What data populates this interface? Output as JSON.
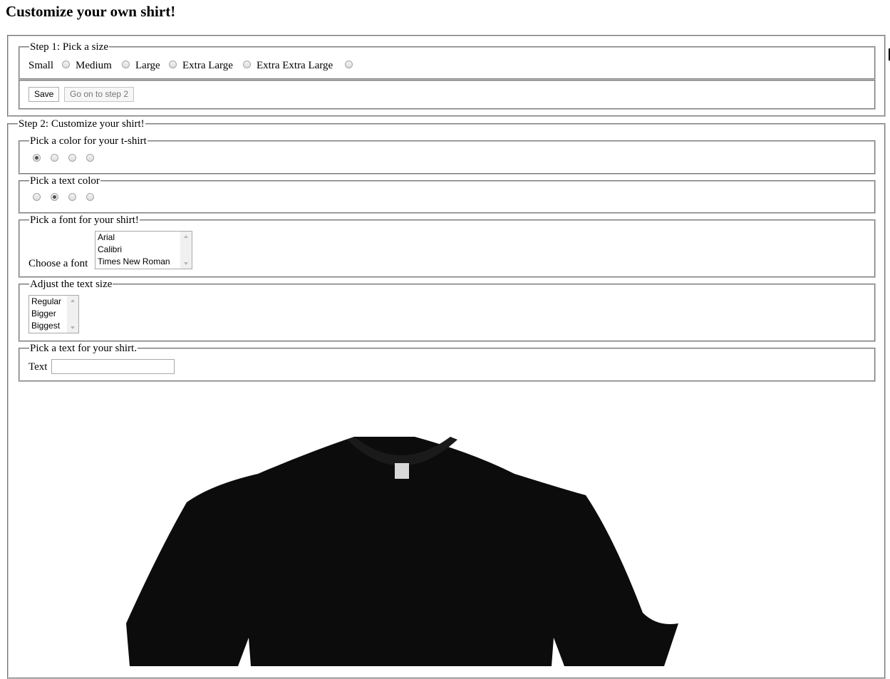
{
  "page_title": "Customize your own shirt!",
  "step1": {
    "legend": "Step 1: Pick a size",
    "sizes": [
      {
        "label": "Small",
        "checked": false
      },
      {
        "label": "Medium",
        "checked": false
      },
      {
        "label": "Large",
        "checked": false
      },
      {
        "label": "Extra Large",
        "checked": false
      },
      {
        "label": "Extra Extra Large",
        "checked": false
      }
    ],
    "save_label": "Save",
    "next_label": "Go on to step 2"
  },
  "step2": {
    "legend": "Step 2: Customize your shirt!",
    "shirt_color": {
      "legend": "Pick a color for your t-shirt",
      "selected_index": 0,
      "count": 4
    },
    "text_color": {
      "legend": "Pick a text color",
      "selected_index": 1,
      "count": 4
    },
    "font": {
      "legend": "Pick a font for your shirt!",
      "label": "Choose a font",
      "options": [
        "Arial",
        "Calibri",
        "Times New Roman"
      ]
    },
    "text_size": {
      "legend": "Adjust the text size",
      "options": [
        "Regular",
        "Bigger",
        "Biggest"
      ]
    },
    "shirt_text": {
      "legend": "Pick a text for your shirt.",
      "label": "Text",
      "value": ""
    }
  },
  "shirt_preview": {
    "color": "#0c0c0c",
    "icon": "t-shirt-image"
  }
}
